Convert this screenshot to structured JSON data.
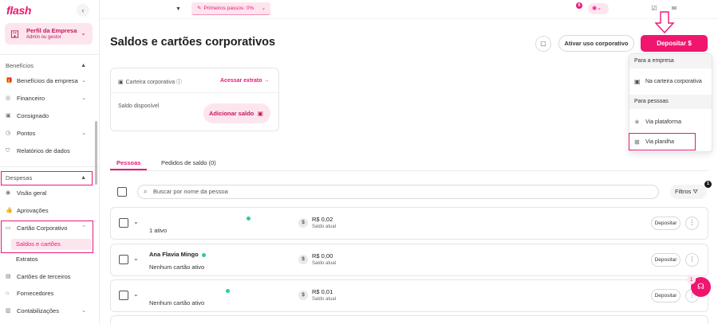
{
  "brand": {
    "logo": "flash",
    "accent": "#f0166f"
  },
  "company": {
    "name": "Perfil da Empresa",
    "role": "Admin ou gestor"
  },
  "sidebar": {
    "sections": [
      {
        "label": "Benefícios",
        "items": [
          {
            "label": "Benefícios da empresa",
            "icon": "gift-icon"
          },
          {
            "label": "Financeiro",
            "icon": "money-icon"
          },
          {
            "label": "Consignado",
            "icon": "loan-icon"
          },
          {
            "label": "Pontos",
            "icon": "clock-icon"
          },
          {
            "label": "Relatórios de dados",
            "icon": "shield-icon"
          }
        ]
      },
      {
        "label": "Despesas",
        "items": [
          {
            "label": "Visão geral",
            "icon": "eye-icon"
          },
          {
            "label": "Aprovações",
            "icon": "thumb-icon"
          },
          {
            "label": "Cartão Corporativo",
            "icon": "card-icon"
          }
        ]
      }
    ],
    "card_subitems": [
      "Saldos e cartões",
      "Extratos"
    ],
    "more_items": [
      {
        "label": "Cartões de terceiros",
        "icon": "cards-icon"
      },
      {
        "label": "Fornecedores",
        "icon": "store-icon"
      },
      {
        "label": "Contabilizações",
        "icon": "book-icon"
      }
    ]
  },
  "topbar": {
    "onboarding": "Primeiros passos: 0%",
    "notif_count": "8"
  },
  "page": {
    "title": "Saldos e cartões corporativos",
    "activate_label": "Ativar uso corporativo",
    "deposit_label": "Depositar"
  },
  "dropdown": {
    "group1": "Para a empresa",
    "item1": "Na carteira corporativa",
    "group2": "Para pessoas",
    "item2": "Via plataforma",
    "item3": "Via planilha"
  },
  "wallet": {
    "label": "Carteira corporativa",
    "link": "Acessar extrato",
    "balance_label": "Saldo disponível",
    "add_label": "Adicionar saldo"
  },
  "tabs": [
    {
      "label": "Pessoas"
    },
    {
      "label": "Pedidos de saldo (0)"
    }
  ],
  "search": {
    "placeholder": "Buscar por nome da pessoa"
  },
  "filters": {
    "label": "Filtros",
    "count": "1"
  },
  "rows": [
    {
      "name": "",
      "status": "1 ativo",
      "amount": "R$ 0,02",
      "amount_sub": "Saldo atual",
      "deposit": "Depositar"
    },
    {
      "name": "Ana Flavia Mingo",
      "status": "Nenhum cartão ativo",
      "amount": "R$ 0,00",
      "amount_sub": "Saldo atual",
      "deposit": "Depositar"
    },
    {
      "name": "",
      "status": "Nenhum cartão ativo",
      "amount": "R$ 0,01",
      "amount_sub": "Saldo atual",
      "deposit": "Depositar"
    }
  ],
  "help": {
    "count": "1"
  }
}
